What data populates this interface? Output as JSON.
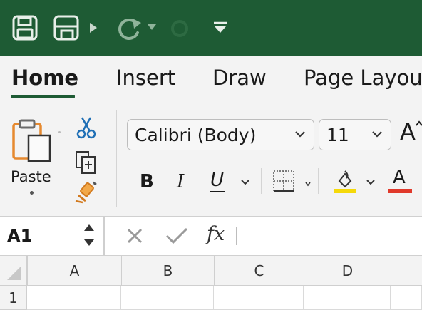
{
  "ribbon_tabs": [
    "Home",
    "Insert",
    "Draw",
    "Page Layout"
  ],
  "clipboard": {
    "paste_label": "Paste"
  },
  "font": {
    "name": "Calibri (Body)",
    "size": "11"
  },
  "formatting": {
    "bold": "B",
    "italic": "I",
    "underline": "U",
    "font_color_letter": "A",
    "grow_font": "A"
  },
  "colors": {
    "title_bar": "#1e5b34",
    "highlight": "#f5d90a",
    "font_color": "#e0392b"
  },
  "formula_bar": {
    "name_box": "A1",
    "fx": "fx"
  },
  "grid": {
    "columns": [
      "A",
      "B",
      "C",
      "D"
    ],
    "rows": [
      "1"
    ]
  }
}
